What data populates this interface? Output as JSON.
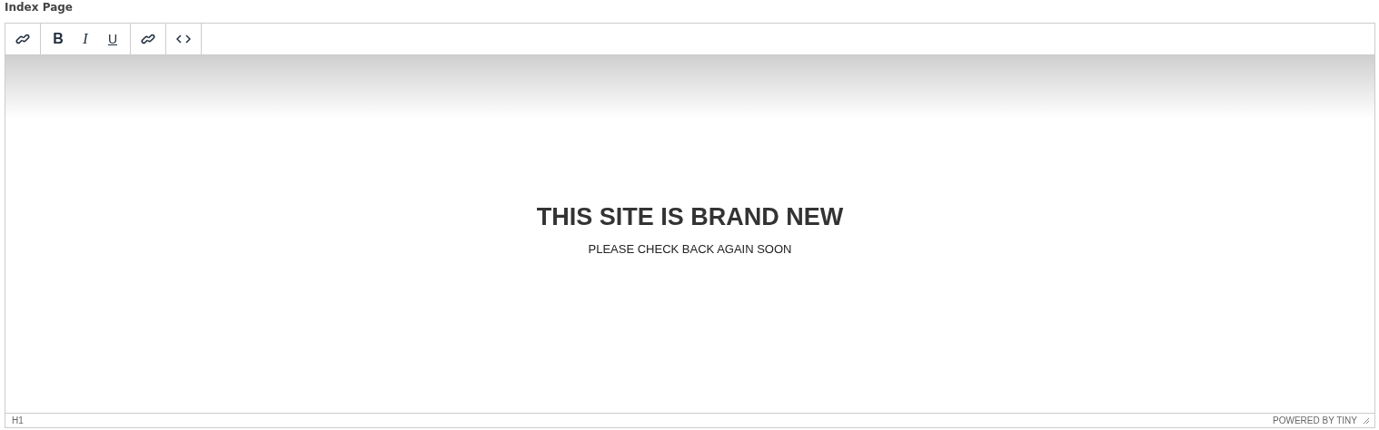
{
  "field_label": "Index Page",
  "toolbar": [
    {
      "buttons": [
        {
          "kind": "link"
        }
      ]
    },
    {
      "buttons": [
        {
          "kind": "bold",
          "label": "B"
        },
        {
          "kind": "italic",
          "label": "I"
        },
        {
          "kind": "underline",
          "label": "U"
        }
      ]
    },
    {
      "buttons": [
        {
          "kind": "link"
        }
      ]
    },
    {
      "buttons": [
        {
          "kind": "code"
        }
      ]
    }
  ],
  "content": {
    "heading": "THIS SITE IS BRAND NEW",
    "subtitle": "PLEASE CHECK BACK AGAIN SOON"
  },
  "status_bar": {
    "path": "H1",
    "branding": "POWERED BY TINY"
  }
}
